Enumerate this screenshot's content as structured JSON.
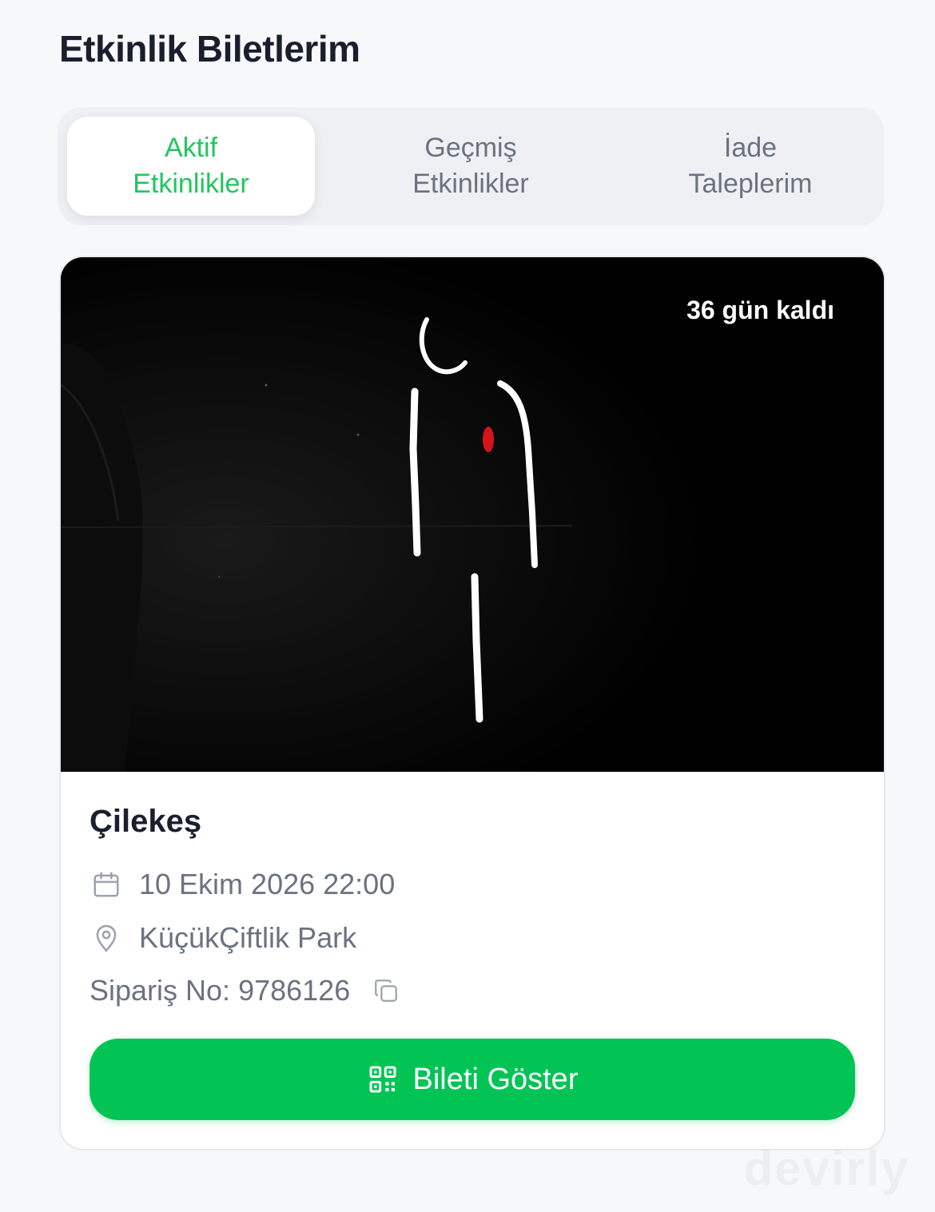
{
  "header": {
    "title": "Etkinlik Biletlerim"
  },
  "tabs": [
    {
      "line1": "Aktif",
      "line2": "Etkinlikler",
      "active": true
    },
    {
      "line1": "Geçmiş",
      "line2": "Etkinlikler",
      "active": false
    },
    {
      "line1": "İade",
      "line2": "Taleplerim",
      "active": false
    }
  ],
  "event": {
    "days_left": "36 gün kaldı",
    "title": "Çilekeş",
    "datetime": "10 Ekim 2026 22:00",
    "venue": "KüçükÇiftlik Park",
    "order": "Sipariş No: 9786126",
    "button_label": "Bileti Göster"
  },
  "icons": {
    "date": "calendar-icon",
    "venue": "location-pin-icon",
    "copy": "copy-icon",
    "button": "qr-code-icon"
  },
  "colors": {
    "accent": "#22c55e",
    "button": "#01c455",
    "title": "#1a1f2e",
    "muted": "#6b7280"
  },
  "watermark": "devirly"
}
